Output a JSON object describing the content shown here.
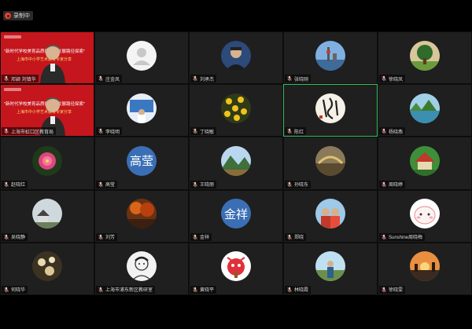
{
  "topbar": {
    "record_label": "录制中"
  },
  "presenters": [
    {
      "line1": "\"新时代学校美育品质提升与发展路径探索\"",
      "line2": "上海市中小学艺术教育专家分享",
      "name": "邓颖 刘镇华"
    },
    {
      "line1": "\"新时代学校美育品质提升与发展路径探索\"",
      "line2": "上海市中小学艺术教育专家分享",
      "name": "上海市虹口区教育局"
    }
  ],
  "participants": [
    {
      "name": "庄金凤",
      "avatar": "placeholder"
    },
    {
      "name": "刘承杰",
      "avatar": "portrait"
    },
    {
      "name": "张晓刚",
      "avatar": "city"
    },
    {
      "name": "徐晓凤",
      "avatar": "tree"
    },
    {
      "name": "李晓明",
      "avatar": "stage"
    },
    {
      "name": "丁晓敏",
      "avatar": "flowers-yellow"
    },
    {
      "name": "陈红",
      "avatar": "calligraphy"
    },
    {
      "name": "杨晓燕",
      "avatar": "lake"
    },
    {
      "name": "赵晓红",
      "avatar": "flower-pink"
    },
    {
      "name": "高莹",
      "avatar": "text",
      "text": "高莹",
      "color": "#3a6fb5"
    },
    {
      "name": "王晓丽",
      "avatar": "mountain"
    },
    {
      "name": "孙晓东",
      "avatar": "bridge"
    },
    {
      "name": "周晓婷",
      "avatar": "garden"
    },
    {
      "name": "吴晓静",
      "avatar": "village"
    },
    {
      "name": "刘芳",
      "avatar": "autumn"
    },
    {
      "name": "金祥",
      "avatar": "text",
      "text": "金祥",
      "color": "#3a6fb5"
    },
    {
      "name": "郑晓",
      "avatar": "group"
    },
    {
      "name": "Sunshine周晓梅",
      "avatar": "cartoon"
    },
    {
      "name": "何晓华",
      "avatar": "mushroom"
    },
    {
      "name": "上海市浦东新区教研室",
      "avatar": "sketch"
    },
    {
      "name": "黄晓平",
      "avatar": "butterfly"
    },
    {
      "name": "林晓霞",
      "avatar": "outdoor"
    },
    {
      "name": "徐晓雯",
      "avatar": "sunset"
    }
  ],
  "colors": {
    "active_border": "#2fbf5a",
    "presenter_bg": "#c4161c",
    "tile_bg": "#1f1f1f"
  }
}
